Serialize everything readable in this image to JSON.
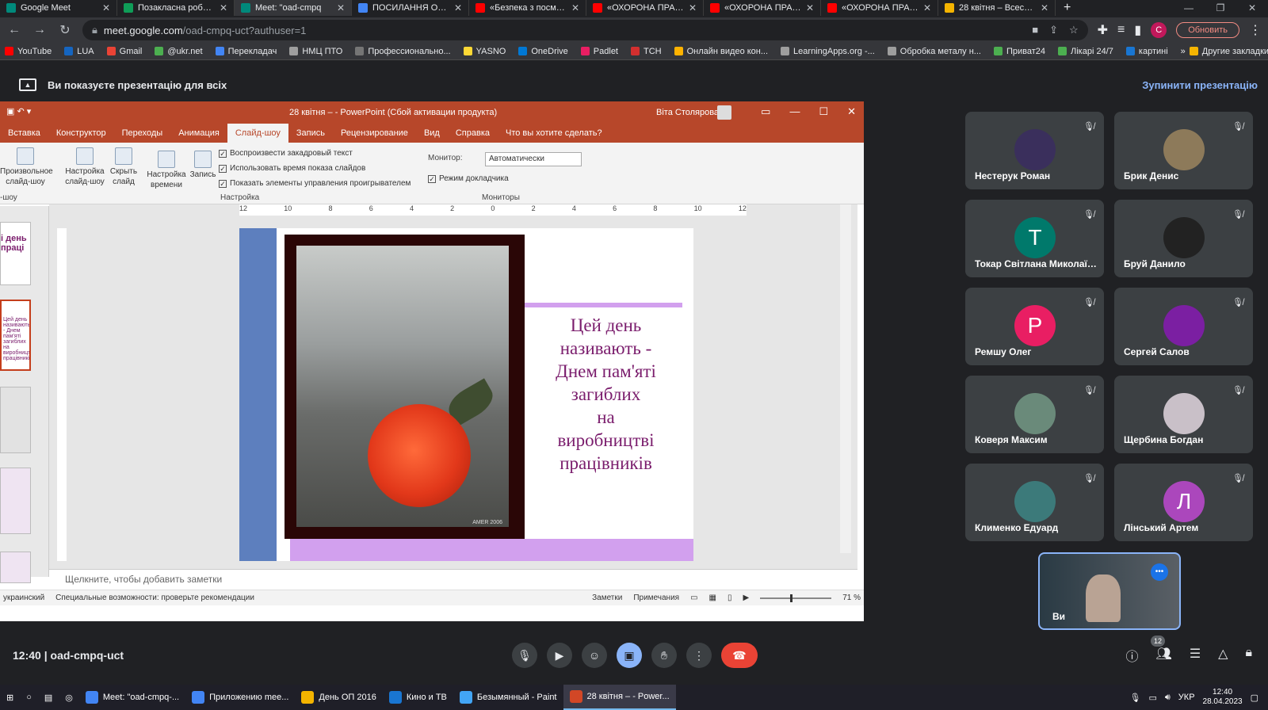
{
  "browser": {
    "tabs": [
      {
        "label": "Google Meet",
        "color": "#00897b",
        "active": false
      },
      {
        "label": "Позакласна робота",
        "color": "#0f9d58",
        "active": false
      },
      {
        "label": "Meet: \"oad-cmpq",
        "color": "#00897b",
        "active": true
      },
      {
        "label": "ПОСИЛАННЯ ОП - G",
        "color": "#4285f4",
        "active": false
      },
      {
        "label": "«Безпека з посмішко",
        "color": "#ff0000",
        "active": false
      },
      {
        "label": "«ОХОРОНА ПРАЦІ - !",
        "color": "#ff0000",
        "active": false
      },
      {
        "label": "«ОХОРОНА ПРАЦІ - !",
        "color": "#ff0000",
        "active": false
      },
      {
        "label": "«ОХОРОНА ПРАЦІ - !",
        "color": "#ff0000",
        "active": false
      },
      {
        "label": "28 квітня – Всесвітні",
        "color": "#f4b400",
        "active": false
      }
    ],
    "url_host": "meet.google.com",
    "url_path": "/oad-cmpq-uct?authuser=1",
    "profile_letter": "C",
    "update_label": "Обновить",
    "bookmarks": [
      {
        "label": "YouTube",
        "color": "#ff0000"
      },
      {
        "label": "LUA",
        "color": "#1565c0"
      },
      {
        "label": "Gmail",
        "color": "#ea4335"
      },
      {
        "label": "@ukr.net",
        "color": "#4caf50"
      },
      {
        "label": "Перекладач",
        "color": "#4285f4"
      },
      {
        "label": "НМЦ ПТО",
        "color": "#9e9e9e"
      },
      {
        "label": "Профессионально...",
        "color": "#757575"
      },
      {
        "label": "YASNO",
        "color": "#fdd835"
      },
      {
        "label": "OneDrive",
        "color": "#0078d4"
      },
      {
        "label": "Padlet",
        "color": "#e91e63"
      },
      {
        "label": "ТСН",
        "color": "#d32f2f"
      },
      {
        "label": "Онлайн видео кон...",
        "color": "#ffb300"
      },
      {
        "label": "LearningApps.org -...",
        "color": "#9e9e9e"
      },
      {
        "label": "Обробка металу н...",
        "color": "#9e9e9e"
      },
      {
        "label": "Приват24",
        "color": "#4caf50"
      },
      {
        "label": "Лікарі 24/7",
        "color": "#4caf50"
      },
      {
        "label": "картині",
        "color": "#1976d2"
      }
    ],
    "other_bookmarks": "Другие закладки"
  },
  "meet": {
    "presenting_banner": "Ви показуєте презентацію для всіх",
    "stop_label": "Зупинити презентацію",
    "time": "12:40",
    "meeting_code": "oad-cmpq-uct",
    "participants_count": "12",
    "participants": [
      {
        "name": "Нестерук Роман",
        "initial": "",
        "color": "#3a2f5c"
      },
      {
        "name": "Брик Денис",
        "initial": "",
        "color": "#8d7a5a"
      },
      {
        "name": "Токар Світлана Миколаїв...",
        "initial": "T",
        "color": "#00796b"
      },
      {
        "name": "Бруй Данило",
        "initial": "",
        "color": "#222"
      },
      {
        "name": "Ремшу Олег",
        "initial": "P",
        "color": "#e91e63"
      },
      {
        "name": "Сергей Салов",
        "initial": "",
        "color": "#7b1fa2"
      },
      {
        "name": "Коверя Максим",
        "initial": "",
        "color": "#6a8a7a"
      },
      {
        "name": "Щербина Богдан",
        "initial": "",
        "color": "#c9c0c8"
      },
      {
        "name": "Клименко Едуард",
        "initial": "",
        "color": "#3c7a7a"
      },
      {
        "name": "Лінський Артем",
        "initial": "Л",
        "color": "#ab47bc"
      }
    ],
    "self_name": "Ви"
  },
  "ppt": {
    "title": "28 квітня – - PowerPoint (Сбой активации продукта)",
    "user": "Віта Столярова",
    "menu": [
      "Вставка",
      "Конструктор",
      "Переходы",
      "Анимация",
      "Слайд-шоу",
      "Запись",
      "Рецензирование",
      "Вид",
      "Справка",
      "Что вы хотите сделать?"
    ],
    "ribbon": {
      "custom_show": "Произвольное слайд-шоу",
      "setup": "Настройка слайд-шоу",
      "hide": "Скрыть слайд",
      "timing": "Настройка времени",
      "record": "Запись",
      "opt1": "Воспроизвести закадровый текст",
      "opt2": "Использовать время показа слайдов",
      "opt3": "Показать элементы управления проигрывателем",
      "group_setup": "Настройка",
      "monitor_label": "Монитор:",
      "monitor_value": "Автоматически",
      "presenter_view": "Режим докладчика",
      "group_monitors": "Мониторы",
      "cut_label": "-шоу"
    },
    "thumb_texts": [
      "і день праці",
      "Цей день називають - Днем пам'яті загиблих на виробництві працівників"
    ],
    "slide_text": "Цей день\nназивають  -\nДнем пам'яті\nзагиблих\nна\nвиробництві\nпрацівників",
    "photo_sig": "AMER 2006",
    "notes_placeholder": "Щелкните, чтобы добавить заметки",
    "status": {
      "lang": "украинский",
      "accessibility": "Специальные возможности: проверьте рекомендации",
      "notes": "Заметки",
      "comments": "Примечания",
      "zoom": "71 %"
    }
  },
  "taskbar": {
    "items": [
      {
        "label": "Meet: \"oad-cmpq-...",
        "color": "#4285f4",
        "active": false
      },
      {
        "label": "Приложению mee...",
        "color": "#4285f4",
        "active": false
      },
      {
        "label": "День ОП 2016",
        "color": "#f4b400",
        "active": false
      },
      {
        "label": "Кино и ТВ",
        "color": "#1976d2",
        "active": false
      },
      {
        "label": "Безымянный - Paint",
        "color": "#42a5f5",
        "active": false
      },
      {
        "label": "28 квітня – - Power...",
        "color": "#d24726",
        "active": true
      }
    ],
    "lang": "УКР",
    "time": "12:40",
    "date": "28.04.2023"
  }
}
